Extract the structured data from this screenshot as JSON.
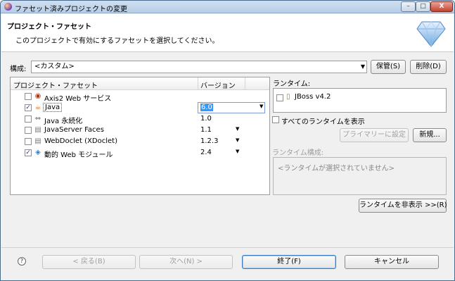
{
  "window": {
    "title": "ファセット済みプロジェクトの変更",
    "controls": {
      "minimize": "–",
      "maximize": "□",
      "close": "X"
    }
  },
  "banner": {
    "title": "プロジェクト・ファセット",
    "description": "このプロジェクトで有効にするファセットを選択してください。",
    "icon": "diamond-gem-icon"
  },
  "configuration": {
    "label": "構成:",
    "selected": "<カスタム>",
    "save_label": "保管(S)",
    "delete_label": "削除(D)"
  },
  "facets_table": {
    "columns": [
      "プロジェクト・ファセット",
      "バージョン"
    ],
    "rows": [
      {
        "name": "Axis2 Web サービス",
        "checked": false,
        "version": "",
        "icon": "axis2-icon",
        "has_dropdown": false
      },
      {
        "name": "Java",
        "checked": true,
        "version": "6.0",
        "icon": "java-icon",
        "has_dropdown": true,
        "selected": true
      },
      {
        "name": "Java 永続化",
        "checked": false,
        "version": "1.0",
        "icon": "jpa-icon",
        "has_dropdown": false
      },
      {
        "name": "JavaServer Faces",
        "checked": false,
        "version": "1.1",
        "icon": "document-icon",
        "has_dropdown": true
      },
      {
        "name": "WebDoclet (XDoclet)",
        "checked": false,
        "version": "1.2.3",
        "icon": "document-icon",
        "has_dropdown": true
      },
      {
        "name": "動的 Web モジュール",
        "checked": true,
        "version": "2.4",
        "icon": "web-module-icon",
        "has_dropdown": true
      }
    ]
  },
  "runtimes": {
    "label": "ランタイム:",
    "items": [
      {
        "name": "JBoss v4.2",
        "checked": false
      }
    ],
    "show_all_label": "すべてのランタイムを表示",
    "make_primary_label": "プライマリーに設定",
    "new_label": "新規...",
    "composition_label": "ランタイム構成:",
    "composition_empty": "<ランタイムが選択されていません>",
    "hide_label": "ランタイムを非表示 >>(R)"
  },
  "footer": {
    "help": "?",
    "back_label": "< 戻る(B)",
    "next_label": "次へ(N) >",
    "finish_label": "終了(F)",
    "cancel_label": "キャンセル"
  },
  "colors": {
    "selection": "#3399ff",
    "titlebar": "#b7cde6",
    "check": "#1d3f9a"
  }
}
